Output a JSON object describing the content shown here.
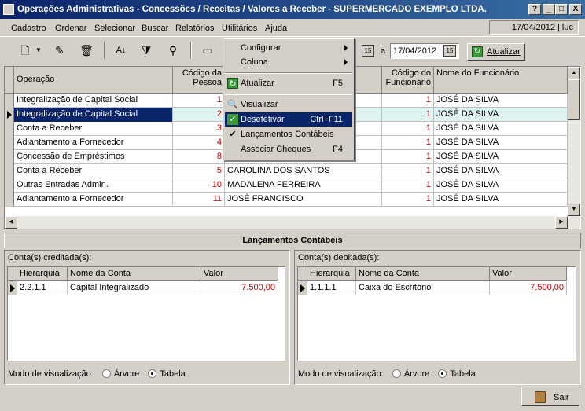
{
  "window": {
    "title": "Operações Administrativas - Concessões / Receitas / Valores a Receber - SUPERMERCADO EXEMPLO LTDA.",
    "buttons": [
      "?",
      "_",
      "□",
      "X"
    ]
  },
  "menu": {
    "items": [
      {
        "id": "cadastro",
        "label": "Cadastro"
      },
      {
        "id": "ordenar",
        "label": "Ordenar"
      },
      {
        "id": "selecionar",
        "label": "Selecionar"
      },
      {
        "id": "buscar",
        "label": "Buscar"
      },
      {
        "id": "relatorios",
        "label": "Relatórios"
      },
      {
        "id": "utilitarios",
        "label": "Utilitários"
      },
      {
        "id": "ajuda",
        "label": "Ajuda"
      }
    ],
    "status": "17/04/2012 | luc"
  },
  "toolbar": {
    "date_connector": "a",
    "date_to": "17/04/2012",
    "cal_label": "15",
    "atualizar_label": "Atualizar"
  },
  "grid": {
    "columns": [
      "Operação",
      "Código da Pessoa",
      "",
      "Código do Funcionário",
      "Nome do Funcionário"
    ],
    "rows": [
      {
        "operacao": "Integralização de Capital Social",
        "codigo": "1",
        "pessoa": "",
        "cod_func": "1",
        "func": "JOSÉ DA SILVA"
      },
      {
        "operacao": "Integralização de Capital Social",
        "codigo": "2",
        "pessoa": "",
        "cod_func": "1",
        "func": "JOSÉ DA SILVA"
      },
      {
        "operacao": "Conta a Receber",
        "codigo": "3",
        "pessoa": "",
        "cod_func": "1",
        "func": "JOSÉ DA SILVA"
      },
      {
        "operacao": "Adiantamento a Fornecedor",
        "codigo": "4",
        "pessoa": "",
        "cod_func": "1",
        "func": "JOSÉ DA SILVA"
      },
      {
        "operacao": "Concessão de Empréstimos",
        "codigo": "8",
        "pessoa": "",
        "cod_func": "1",
        "func": "JOSÉ DA SILVA"
      },
      {
        "operacao": "Conta a Receber",
        "codigo": "5",
        "pessoa": "CAROLINA DOS SANTOS",
        "cod_func": "1",
        "func": "JOSÉ DA SILVA"
      },
      {
        "operacao": "Outras Entradas Admin.",
        "codigo": "10",
        "pessoa": "MADALENA FERREIRA",
        "cod_func": "1",
        "func": "JOSÉ DA SILVA"
      },
      {
        "operacao": "Adiantamento a Fornecedor",
        "codigo": "11",
        "pessoa": "JOSÉ FRANCISCO",
        "cod_func": "1",
        "func": "JOSÉ DA SILVA"
      }
    ]
  },
  "dropdown": {
    "configurar": "Configurar",
    "coluna": "Coluna",
    "atualizar": "Atualizar",
    "atualizar_sc": "F5",
    "visualizar": "Visualizar",
    "desefetivar": "Desefetivar",
    "desefetivar_sc": "Ctrl+F11",
    "lancamentos": "Lançamentos Contábeis",
    "associar": "Associar Cheques",
    "associar_sc": "F4"
  },
  "lanc": {
    "header": "Lançamentos Contábeis",
    "credit": {
      "title": "Conta(s) creditada(s):",
      "cols": [
        "Hierarquia",
        "Nome da Conta",
        "Valor"
      ],
      "row": {
        "hier": "2.2.1.1",
        "conta": "Capital Integralizado",
        "valor": "7.500,00"
      }
    },
    "debit": {
      "title": "Conta(s) debitada(s):",
      "cols": [
        "Hierarquia",
        "Nome da Conta",
        "Valor"
      ],
      "row": {
        "hier": "1.1.1.1",
        "conta": "Caixa do Escritório",
        "valor": "7.500,00"
      }
    },
    "modo": "Modo de visualização:",
    "arvore": "Árvore",
    "tabela": "Tabela"
  },
  "sair": "Sair",
  "colors": {
    "selection": "#0a246a",
    "number_red": "#c00000"
  }
}
